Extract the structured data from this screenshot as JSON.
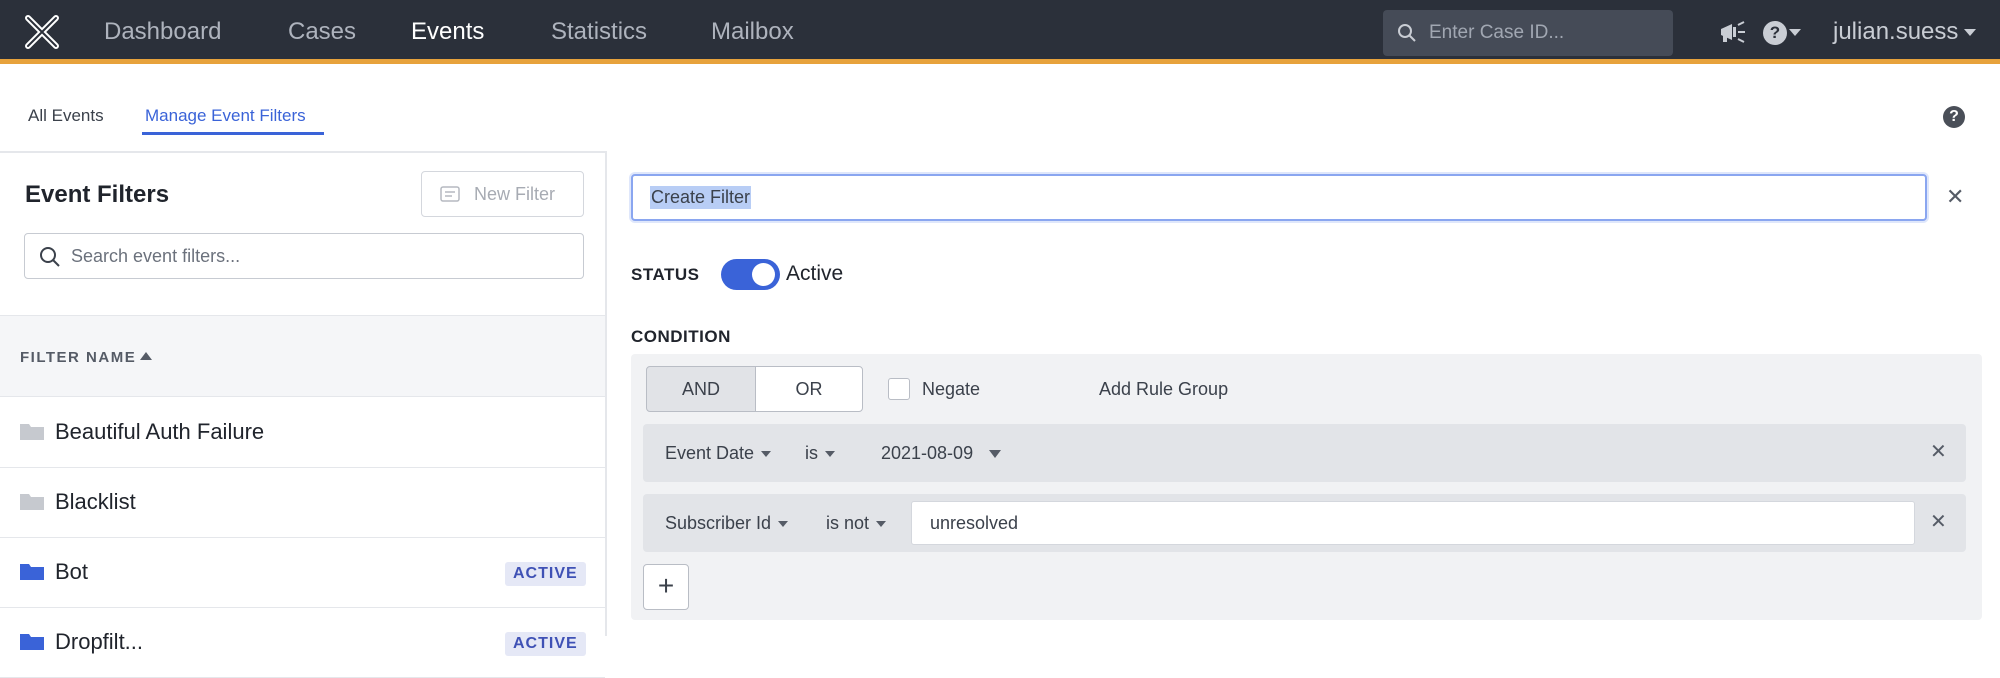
{
  "nav": {
    "items": [
      "Dashboard",
      "Cases",
      "Events",
      "Statistics",
      "Mailbox"
    ],
    "active": "Events",
    "search_placeholder": "Enter Case ID...",
    "user": "julian.suess"
  },
  "tabs": {
    "all_events": "All Events",
    "manage_filters": "Manage Event Filters"
  },
  "left": {
    "title": "Event Filters",
    "new_filter": "New Filter",
    "search_placeholder": "Search event filters...",
    "column_header": "FILTER NAME",
    "rows": [
      {
        "name": "Beautiful Auth Failure",
        "badge": ""
      },
      {
        "name": "Blacklist",
        "badge": ""
      },
      {
        "name": "Bot",
        "badge": "ACTIVE"
      },
      {
        "name": "Dropfilt...",
        "badge": "ACTIVE"
      }
    ]
  },
  "editor": {
    "filter_name": "Create Filter",
    "status_label": "STATUS",
    "status_value": "Active",
    "condition_label": "CONDITION",
    "and_label": "AND",
    "or_label": "OR",
    "negate_label": "Negate",
    "add_rule_group": "Add Rule Group",
    "rules": [
      {
        "field": "Event Date",
        "op": "is",
        "value": "2021-08-09"
      },
      {
        "field": "Subscriber Id",
        "op": "is not",
        "value": "unresolved"
      }
    ],
    "add_rule": "+"
  },
  "colors": {
    "topbar": "#2b303a",
    "accent_bar": "#e7a23c",
    "primary": "#3a63d8"
  }
}
